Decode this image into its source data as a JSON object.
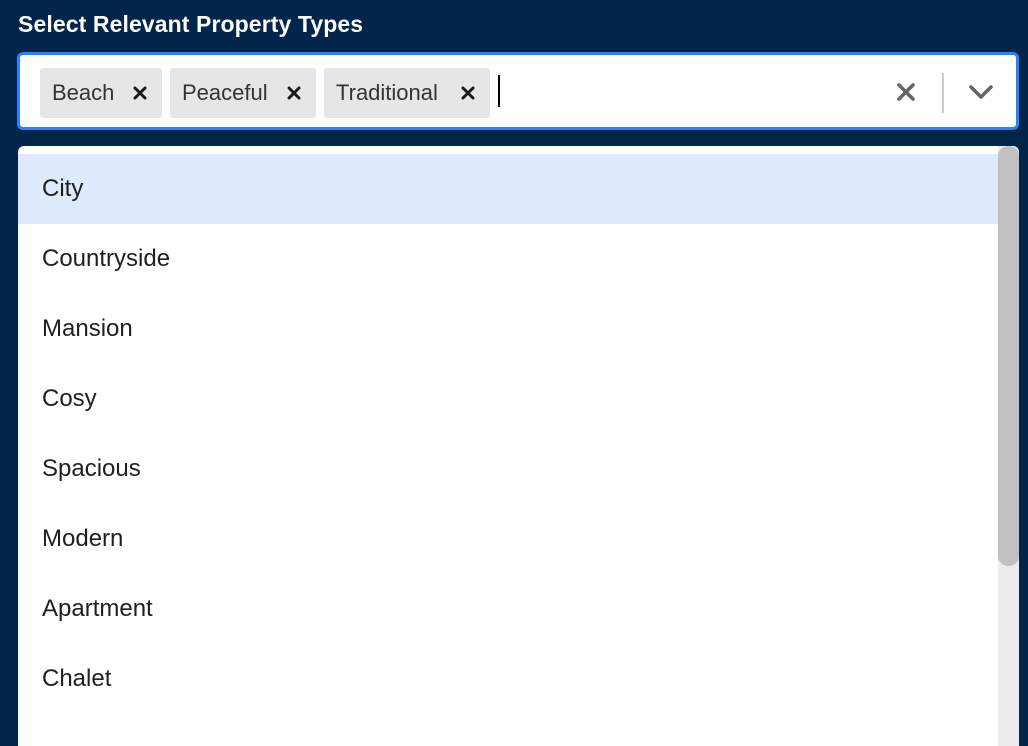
{
  "field": {
    "label": "Select Relevant Property Types"
  },
  "selected": [
    {
      "label": "Beach"
    },
    {
      "label": "Peaceful"
    },
    {
      "label": "Traditional"
    }
  ],
  "options": [
    {
      "label": "City",
      "focused": true
    },
    {
      "label": "Countryside"
    },
    {
      "label": "Mansion"
    },
    {
      "label": "Cosy"
    },
    {
      "label": "Spacious"
    },
    {
      "label": "Modern"
    },
    {
      "label": "Apartment"
    },
    {
      "label": "Chalet"
    }
  ],
  "icons": {
    "chip_remove": "close-icon",
    "clear": "close-icon",
    "dropdown": "chevron-down-icon"
  },
  "colors": {
    "page_background": "#02254a",
    "focus_border": "#2684ff",
    "option_focused": "#deebff",
    "chip_background": "#e6e6e6"
  },
  "scroll": {
    "fraction_visible": 0.7
  }
}
